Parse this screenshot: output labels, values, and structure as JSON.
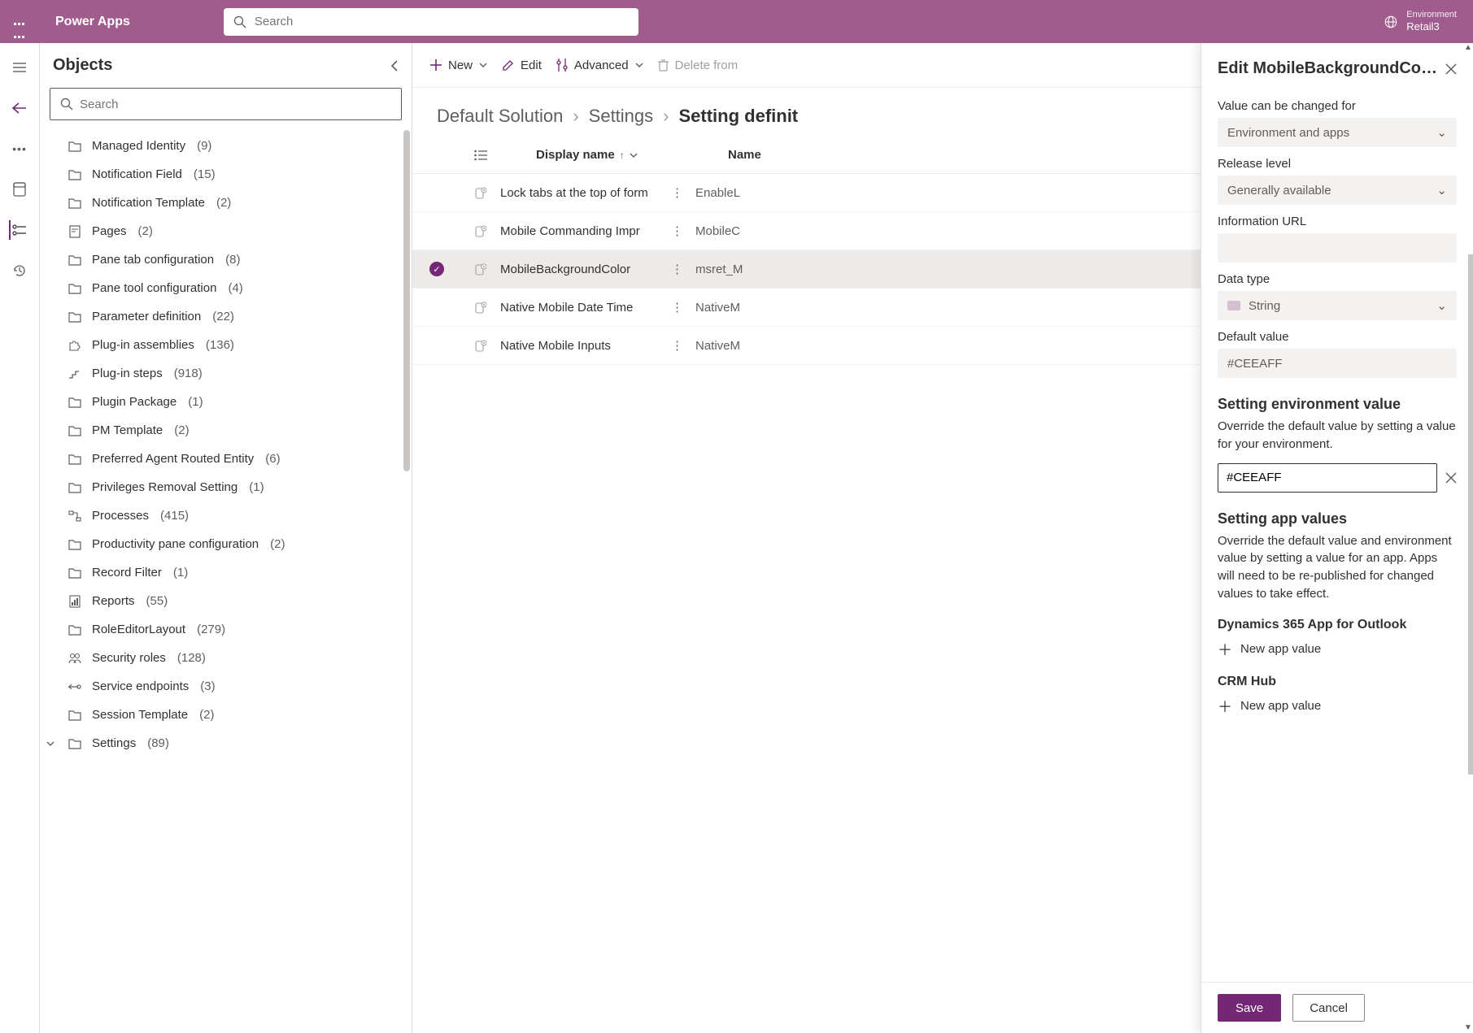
{
  "header": {
    "app_title": "Power Apps",
    "search_placeholder": "Search",
    "env_label": "Environment",
    "env_name": "Retail3"
  },
  "objects": {
    "title": "Objects",
    "search_placeholder": "Search",
    "items": [
      {
        "label": "Managed Identity",
        "count": "(9)",
        "icon": "folder"
      },
      {
        "label": "Notification Field",
        "count": "(15)",
        "icon": "folder"
      },
      {
        "label": "Notification Template",
        "count": "(2)",
        "icon": "folder"
      },
      {
        "label": "Pages",
        "count": "(2)",
        "icon": "page"
      },
      {
        "label": "Pane tab configuration",
        "count": "(8)",
        "icon": "folder"
      },
      {
        "label": "Pane tool configuration",
        "count": "(4)",
        "icon": "folder"
      },
      {
        "label": "Parameter definition",
        "count": "(22)",
        "icon": "folder"
      },
      {
        "label": "Plug-in assemblies",
        "count": "(136)",
        "icon": "puzzle"
      },
      {
        "label": "Plug-in steps",
        "count": "(918)",
        "icon": "steps"
      },
      {
        "label": "Plugin Package",
        "count": "(1)",
        "icon": "folder"
      },
      {
        "label": "PM Template",
        "count": "(2)",
        "icon": "folder"
      },
      {
        "label": "Preferred Agent Routed Entity",
        "count": "(6)",
        "icon": "folder"
      },
      {
        "label": "Privileges Removal Setting",
        "count": "(1)",
        "icon": "folder"
      },
      {
        "label": "Processes",
        "count": "(415)",
        "icon": "process"
      },
      {
        "label": "Productivity pane configuration",
        "count": "(2)",
        "icon": "folder"
      },
      {
        "label": "Record Filter",
        "count": "(1)",
        "icon": "folder"
      },
      {
        "label": "Reports",
        "count": "(55)",
        "icon": "report"
      },
      {
        "label": "RoleEditorLayout",
        "count": "(279)",
        "icon": "folder"
      },
      {
        "label": "Security roles",
        "count": "(128)",
        "icon": "role"
      },
      {
        "label": "Service endpoints",
        "count": "(3)",
        "icon": "endpoint"
      },
      {
        "label": "Session Template",
        "count": "(2)",
        "icon": "folder"
      },
      {
        "label": "Settings",
        "count": "(89)",
        "icon": "folder",
        "expand": true
      }
    ]
  },
  "cmdbar": {
    "new": "New",
    "edit": "Edit",
    "advanced": "Advanced",
    "delete": "Delete from"
  },
  "breadcrumb": {
    "a": "Default Solution",
    "b": "Settings",
    "c": "Setting definit"
  },
  "table": {
    "col_display": "Display name",
    "col_name": "Name",
    "rows": [
      {
        "display": "Lock tabs at the top of form",
        "name": "EnableL",
        "selected": false
      },
      {
        "display": "Mobile Commanding Impr",
        "name": "MobileC",
        "selected": false
      },
      {
        "display": "MobileBackgroundColor",
        "name": "msret_M",
        "selected": true
      },
      {
        "display": "Native Mobile Date Time",
        "name": "NativeM",
        "selected": false
      },
      {
        "display": "Native Mobile Inputs",
        "name": "NativeM",
        "selected": false
      }
    ]
  },
  "drawer": {
    "title": "Edit MobileBackgroundCo…",
    "val_label": "Value can be changed for",
    "val_value": "Environment and apps",
    "rel_label": "Release level",
    "rel_value": "Generally available",
    "info_label": "Information URL",
    "type_label": "Data type",
    "type_value": "String",
    "def_label": "Default value",
    "def_value": "#CEEAFF",
    "env_h": "Setting environment value",
    "env_p": "Override the default value by setting a value for your environment.",
    "env_value": "#CEEAFF",
    "app_h": "Setting app values",
    "app_p": "Override the default value and environment value by setting a value for an app. Apps will need to be re-published for changed values to take effect.",
    "apps": [
      {
        "name": "Dynamics 365 App for Outlook",
        "add": "New app value"
      },
      {
        "name": "CRM Hub",
        "add": "New app value"
      }
    ],
    "save": "Save",
    "cancel": "Cancel"
  }
}
